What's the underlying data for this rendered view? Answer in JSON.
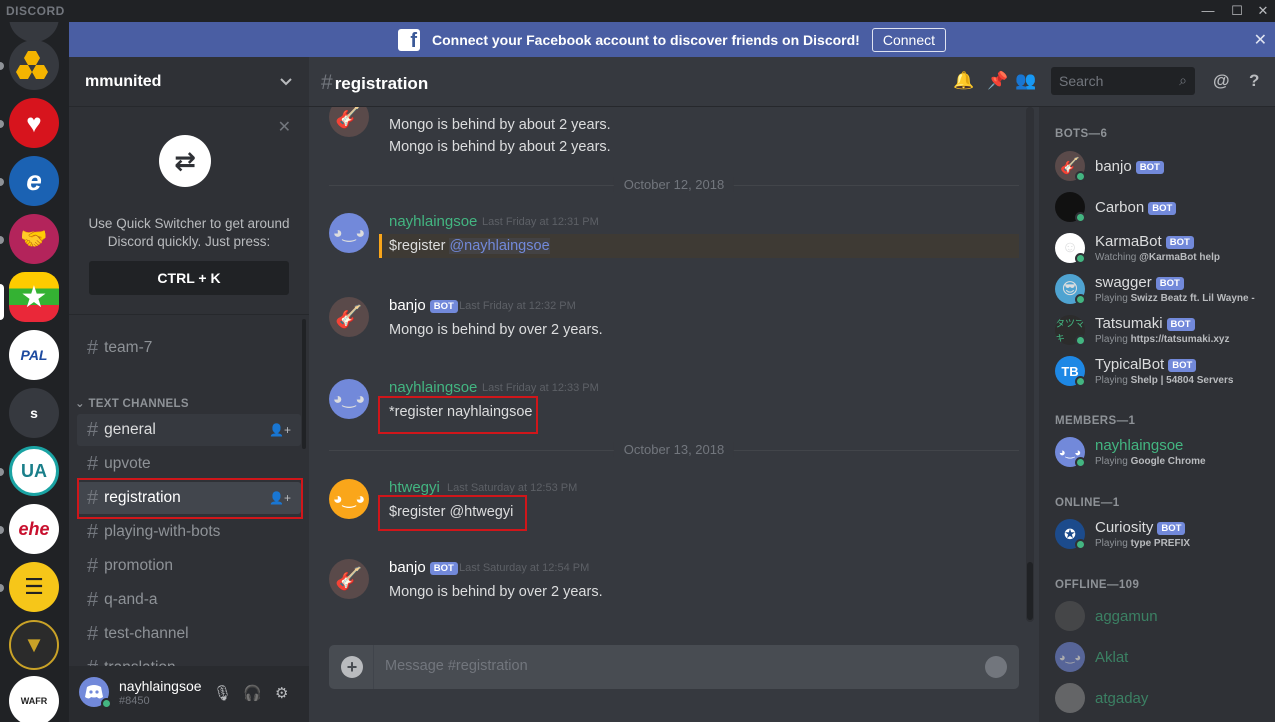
{
  "app": {
    "logo": "DISCORD"
  },
  "window": {
    "minimize": "—",
    "maximize": "☐",
    "close": "✕"
  },
  "banner": {
    "text": "Connect your Facebook account to discover friends on Discord!",
    "button": "Connect",
    "close": "✕",
    "fb": "f"
  },
  "server": {
    "name": "mmunited",
    "guild_s": "s"
  },
  "quick_switcher": {
    "text": "Use Quick Switcher to get around Discord quickly. Just press:",
    "key": "CTRL + K"
  },
  "channels": {
    "top": "team-7",
    "category": "TEXT CHANNELS",
    "list": [
      "general",
      "upvote",
      "registration",
      "playing-with-bots",
      "promotion",
      "q-and-a",
      "test-channel",
      "translation"
    ]
  },
  "user": {
    "name": "nayhlaingsoe",
    "tag": "#8450"
  },
  "chat": {
    "channel": "registration",
    "search_placeholder": "Search",
    "input_placeholder": "Message #registration",
    "partial_name": "banjo",
    "top_lines": [
      "Mongo is behind by about 2 years.",
      "Mongo is behind by about 2 years."
    ],
    "dividers": [
      "October 12, 2018",
      "October 13, 2018"
    ],
    "messages": [
      {
        "author": "nayhlaingsoe",
        "time": "Last Friday at 12:31 PM",
        "text": "$register ",
        "mention": "@nayhlaingsoe"
      },
      {
        "author": "banjo",
        "bot": "BOT",
        "time": "Last Friday at 12:32 PM",
        "text": "Mongo is behind by over 2 years."
      },
      {
        "author": "nayhlaingsoe",
        "time": "Last Friday at 12:33 PM",
        "text": "*register nayhlaingsoe"
      },
      {
        "author": "htwegyi",
        "time": "Last Saturday at 12:53 PM",
        "text": "$register @htwegyi"
      },
      {
        "author": "banjo",
        "bot": "BOT",
        "time": "Last Saturday at 12:54 PM",
        "text": "Mongo is behind by over 2 years."
      }
    ]
  },
  "members": {
    "bots_header": "BOTS—6",
    "bots": [
      {
        "name": "banjo",
        "status": ""
      },
      {
        "name": "Carbon",
        "status": ""
      },
      {
        "name": "KarmaBot",
        "pre": "Watching ",
        "status": "@KarmaBot help"
      },
      {
        "name": "swagger",
        "pre": "Playing ",
        "status": "Swizz Beatz ft. Lil Wayne -"
      },
      {
        "name": "Tatsumaki",
        "pre": "Playing ",
        "status": "https://tatsumaki.xyz"
      },
      {
        "name": "TypicalBot",
        "pre": "Playing ",
        "status": "Shelp | 54804 Servers"
      }
    ],
    "members_header": "MEMBERS—1",
    "member1": {
      "name": "nayhlaingsoe",
      "pre": "Playing ",
      "status": "Google Chrome"
    },
    "online_header": "ONLINE—1",
    "online1": {
      "name": "Curiosity",
      "pre": "Playing ",
      "status": "type PREFIX"
    },
    "offline_header": "OFFLINE—109",
    "offline": [
      "aggamun",
      "Aklat",
      "atgaday"
    ],
    "bot_badge": "BOT"
  },
  "colors": {
    "blurple": "#7289da",
    "green": "#43b581",
    "red_highlight": "#d0161a",
    "banner": "#4a5ea3"
  }
}
